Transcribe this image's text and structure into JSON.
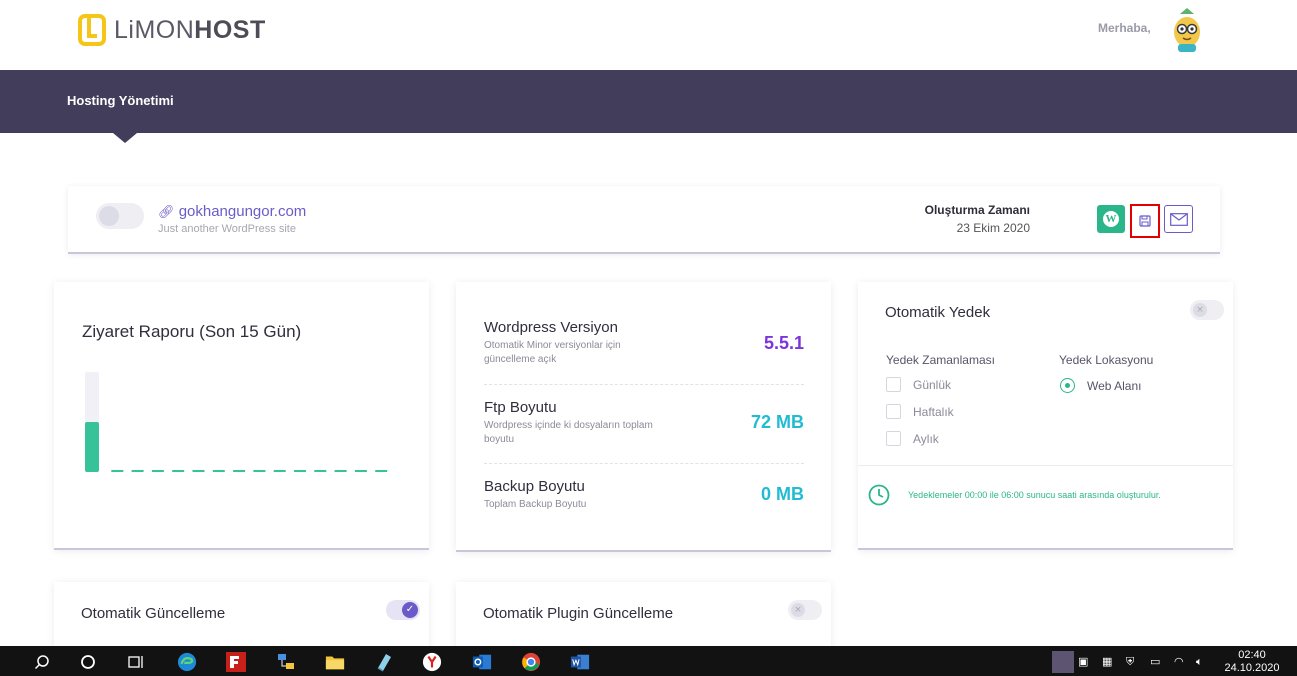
{
  "header": {
    "logo_light": "LiMON",
    "logo_bold": "HOST",
    "greeting": "Merhaba,"
  },
  "nav": {
    "title": "Hosting Yönetimi"
  },
  "site": {
    "domain": "gokhangungor.com",
    "tagline": "Just another WordPress site",
    "created_label": "Oluşturma Zamanı",
    "created_value": "23 Ekim 2020",
    "wp_letter": "W"
  },
  "visit_report": {
    "title": "Ziyaret Raporu (Son 15 Gün)",
    "chart_data": {
      "type": "bar",
      "values": [
        1,
        0,
        0,
        0,
        0,
        0,
        0,
        0,
        0,
        0,
        0,
        0,
        0,
        0,
        0
      ],
      "ylim": [
        0,
        2
      ]
    }
  },
  "stats": {
    "wp_version": {
      "name": "Wordpress Versiyon",
      "desc": "Otomatik Minor versiyonlar için güncelleme açık",
      "value": "5.5.1"
    },
    "ftp_size": {
      "name": "Ftp Boyutu",
      "desc": "Wordpress içinde ki dosyaların toplam boyutu",
      "value": "72 MB"
    },
    "backup_size": {
      "name": "Backup Boyutu",
      "desc": "Toplam Backup Boyutu",
      "value": "0 MB"
    }
  },
  "auto_backup": {
    "title": "Otomatik Yedek",
    "schedule_label": "Yedek Zamanlaması",
    "location_label": "Yedek Lokasyonu",
    "options": [
      "Günlük",
      "Haftalık",
      "Aylık"
    ],
    "location_option": "Web Alanı",
    "note": "Yedeklemeler 00:00 ile 06:00 sunucu saati arasında oluşturulur."
  },
  "auto_update": {
    "title": "Otomatik Güncelleme",
    "enabled": true
  },
  "auto_plugin_update": {
    "title": "Otomatik Plugin Güncelleme",
    "enabled": false
  },
  "taskbar": {
    "time": "02:40",
    "date": "24.10.2020"
  },
  "colors": {
    "nav": "#433d5c",
    "accent": "#6a5cc8",
    "green": "#2bb58b",
    "version": "#7b35d8",
    "size": "#1fbcd2"
  }
}
